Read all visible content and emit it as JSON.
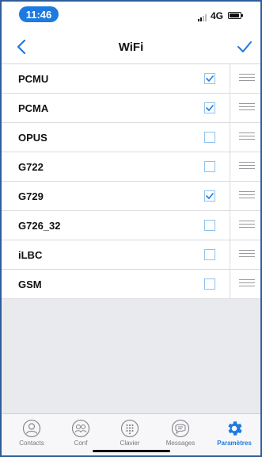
{
  "status_bar": {
    "time": "11:46",
    "network": "4G"
  },
  "navbar": {
    "title": "WiFi"
  },
  "codecs": [
    {
      "name": "PCMU",
      "checked": true
    },
    {
      "name": "PCMA",
      "checked": true
    },
    {
      "name": "OPUS",
      "checked": false
    },
    {
      "name": "G722",
      "checked": false
    },
    {
      "name": "G729",
      "checked": true
    },
    {
      "name": "G726_32",
      "checked": false
    },
    {
      "name": "iLBC",
      "checked": false
    },
    {
      "name": "GSM",
      "checked": false
    }
  ],
  "tabs": [
    {
      "label": "Contacts",
      "icon": "contacts-icon",
      "active": false
    },
    {
      "label": "Conf",
      "icon": "conference-icon",
      "active": false
    },
    {
      "label": "Clavier",
      "icon": "keypad-icon",
      "active": false
    },
    {
      "label": "Messages",
      "icon": "messages-icon",
      "active": false
    },
    {
      "label": "Paramètres",
      "icon": "settings-gear-icon",
      "active": true
    }
  ],
  "colors": {
    "accent": "#1d7ae0",
    "checkbox_border": "#8ec2ee",
    "background": "#e9eaee"
  }
}
